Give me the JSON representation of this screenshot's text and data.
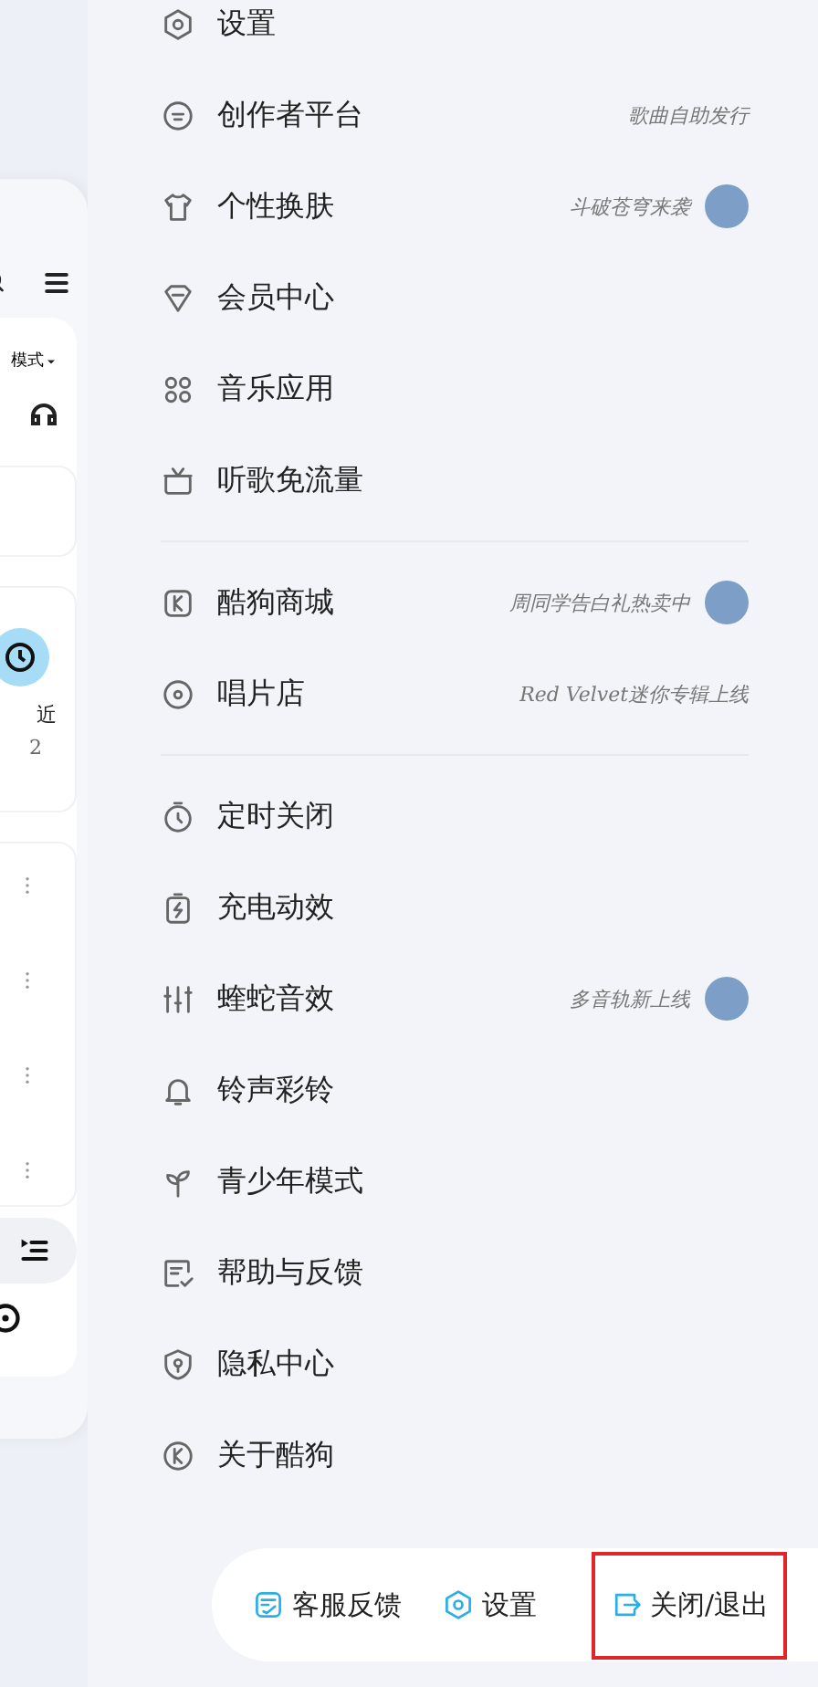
{
  "background_page": {
    "mode_chip": "模式",
    "recent_label": "近",
    "recent_count": "2"
  },
  "menu_groups": [
    {
      "items": [
        {
          "label": "设置",
          "avatar": false
        },
        {
          "label": "创作者平台",
          "note": "歌曲自助发行",
          "avatar": false
        },
        {
          "label": "个性换肤",
          "note": "斗破苍穹来袭",
          "avatar": true
        },
        {
          "label": "会员中心",
          "avatar": false
        },
        {
          "label": "音乐应用",
          "avatar": false
        },
        {
          "label": "听歌免流量",
          "avatar": false
        }
      ]
    },
    {
      "items": [
        {
          "label": "酷狗商城",
          "note": "周同学告白礼热卖中",
          "avatar": true
        },
        {
          "label": "唱片店",
          "note": "Red Velvet迷你专辑上线",
          "avatar": false
        }
      ]
    },
    {
      "items": [
        {
          "label": "定时关闭",
          "avatar": false
        },
        {
          "label": "充电动效",
          "avatar": false
        },
        {
          "label": "蝰蛇音效",
          "note": "多音轨新上线",
          "avatar": true
        },
        {
          "label": "铃声彩铃",
          "avatar": false
        },
        {
          "label": "青少年模式",
          "avatar": false
        },
        {
          "label": "帮助与反馈",
          "avatar": false
        },
        {
          "label": "隐私中心",
          "avatar": false
        },
        {
          "label": "关于酷狗",
          "avatar": false
        }
      ]
    }
  ],
  "footer": [
    {
      "label": "客服反馈",
      "highlighted": false
    },
    {
      "label": "设置",
      "highlighted": false
    },
    {
      "label": "关闭/退出",
      "highlighted": true
    }
  ]
}
